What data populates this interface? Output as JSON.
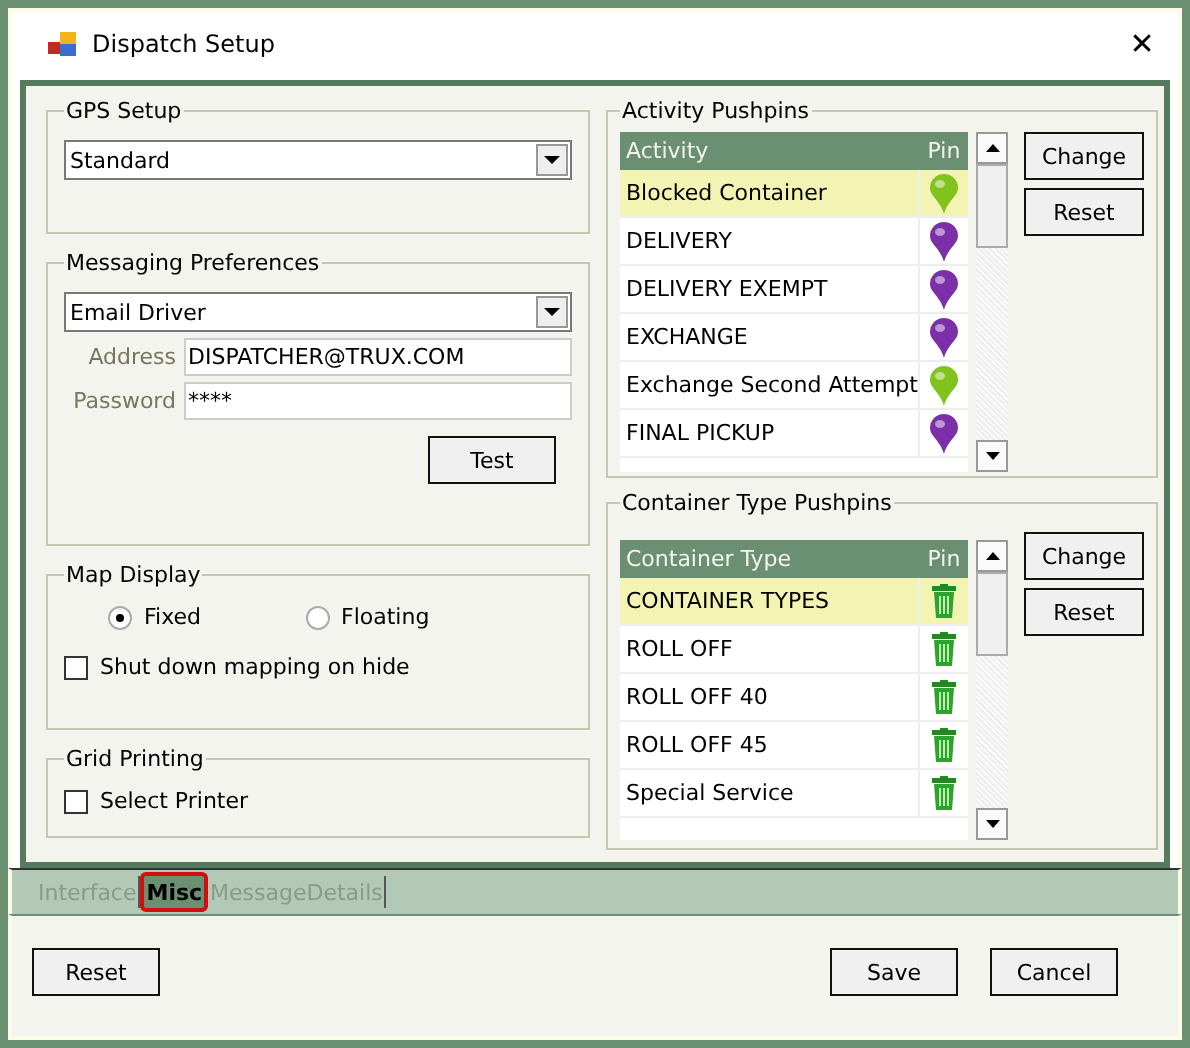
{
  "window": {
    "title": "Dispatch Setup",
    "close": "✕"
  },
  "gps_setup": {
    "legend": "GPS Setup",
    "value": "Standard"
  },
  "messaging": {
    "legend": "Messaging Preferences",
    "method": "Email Driver",
    "fields": [
      {
        "label": "Address",
        "value": "DISPATCHER@TRUX.COM"
      },
      {
        "label": "Password",
        "value": "****"
      }
    ],
    "test_button": "Test"
  },
  "map_display": {
    "legend": "Map Display",
    "options": [
      {
        "label": "Fixed",
        "selected": true
      },
      {
        "label": "Floating",
        "selected": false
      }
    ],
    "shutdown": {
      "label": "Shut down mapping on hide",
      "checked": false
    }
  },
  "grid_printing": {
    "legend": "Grid Printing",
    "select_printer": {
      "label": "Select Printer",
      "checked": false
    }
  },
  "activity_pushpins": {
    "legend": "Activity Pushpins",
    "columns": [
      "Activity",
      "Pin"
    ],
    "rows": [
      {
        "name": "Blocked Container",
        "color": "#7fc31c",
        "selected": true
      },
      {
        "name": "DELIVERY",
        "color": "#7b2fa8",
        "selected": false
      },
      {
        "name": "DELIVERY EXEMPT",
        "color": "#7b2fa8",
        "selected": false
      },
      {
        "name": "EXCHANGE",
        "color": "#7b2fa8",
        "selected": false
      },
      {
        "name": "Exchange Second Attempt",
        "color": "#7fc31c",
        "selected": false
      },
      {
        "name": "FINAL PICKUP",
        "color": "#7b2fa8",
        "selected": false
      }
    ],
    "buttons": [
      {
        "label": "Change"
      },
      {
        "label": "Reset"
      }
    ]
  },
  "container_pushpins": {
    "legend": "Container Type Pushpins",
    "columns": [
      "Container Type",
      "Pin"
    ],
    "rows": [
      {
        "name": "CONTAINER TYPES",
        "selected": true
      },
      {
        "name": "ROLL OFF",
        "selected": false
      },
      {
        "name": "ROLL OFF 40",
        "selected": false
      },
      {
        "name": "ROLL OFF 45",
        "selected": false
      },
      {
        "name": "Special Service",
        "selected": false
      }
    ],
    "buttons": [
      {
        "label": "Change"
      },
      {
        "label": "Reset"
      }
    ]
  },
  "tabs": [
    {
      "label": "Interface",
      "selected": false
    },
    {
      "label": "Misc",
      "selected": true
    },
    {
      "label": "MessageDetails",
      "selected": false
    }
  ],
  "footer": {
    "left": [
      {
        "label": "Reset"
      }
    ],
    "right": [
      {
        "label": "Save"
      },
      {
        "label": "Cancel"
      }
    ]
  }
}
